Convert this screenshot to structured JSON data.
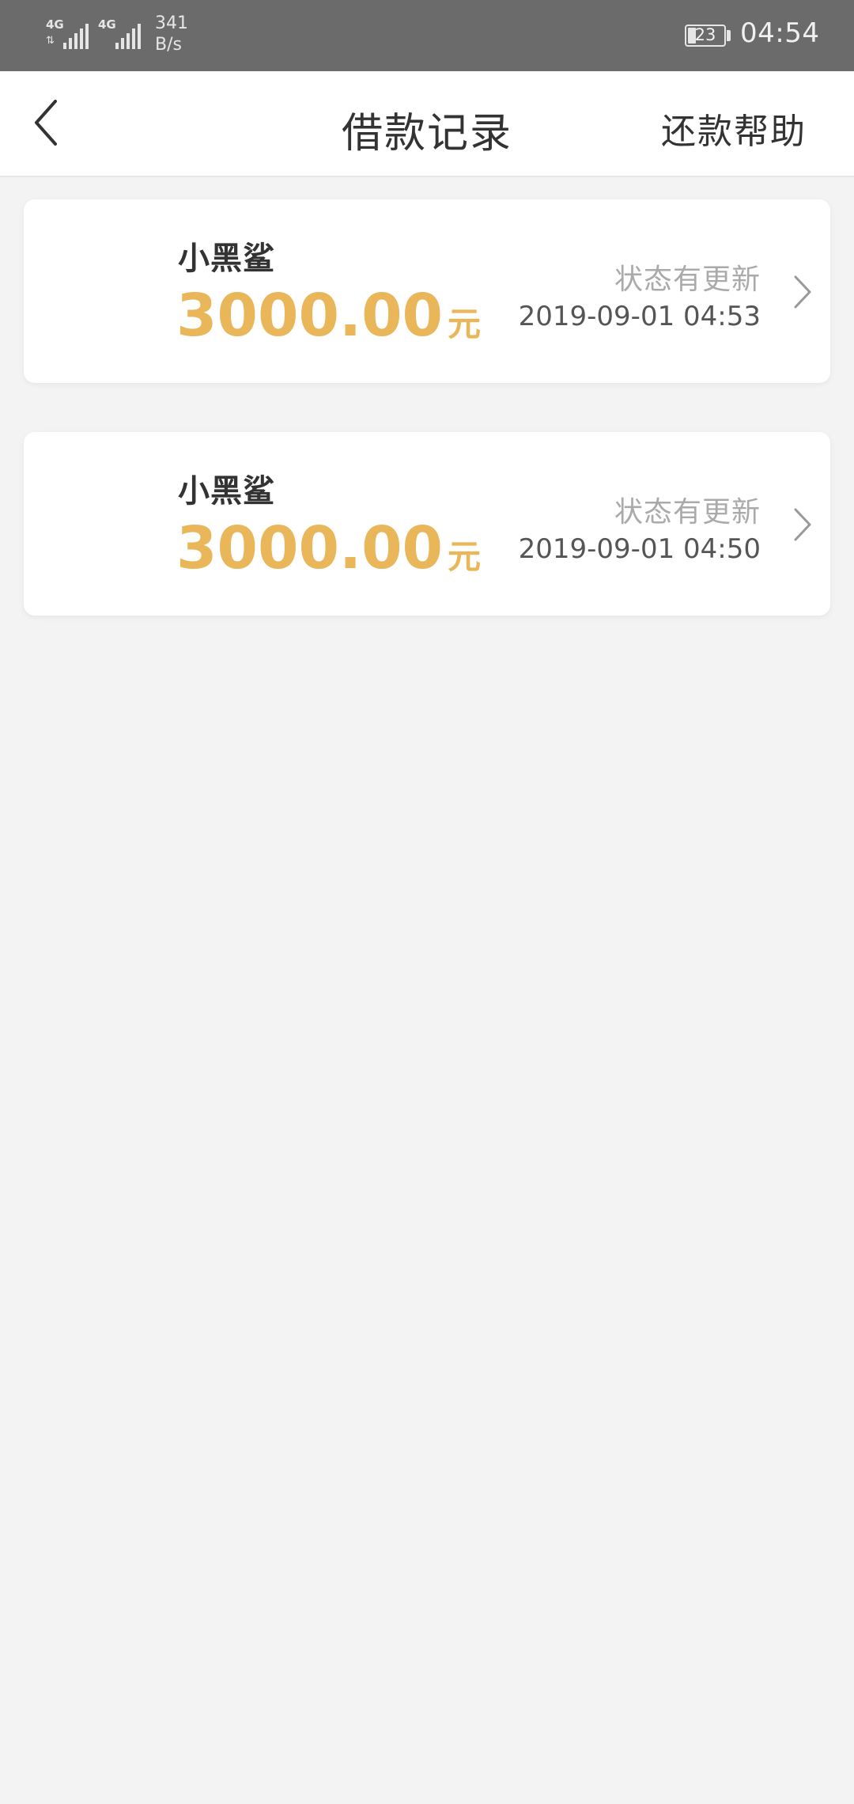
{
  "status_bar": {
    "network1": "4G",
    "network2": "4G",
    "speed_value": "341",
    "speed_unit": "B/s",
    "battery_level": "23",
    "time": "04:54"
  },
  "header": {
    "title": "借款记录",
    "help_label": "还款帮助"
  },
  "records": [
    {
      "name": "小黑鲨",
      "amount": "3000.00",
      "unit": "元",
      "status": "状态有更新",
      "datetime": "2019-09-01 04:53"
    },
    {
      "name": "小黑鲨",
      "amount": "3000.00",
      "unit": "元",
      "status": "状态有更新",
      "datetime": "2019-09-01 04:50"
    }
  ],
  "colors": {
    "accent": "#eab65a",
    "status_bar": "#6b6b6b",
    "background": "#f4f3f4"
  },
  "icons": [
    "back-arrow-icon",
    "chevron-right-icon",
    "signal-icon",
    "battery-icon"
  ]
}
